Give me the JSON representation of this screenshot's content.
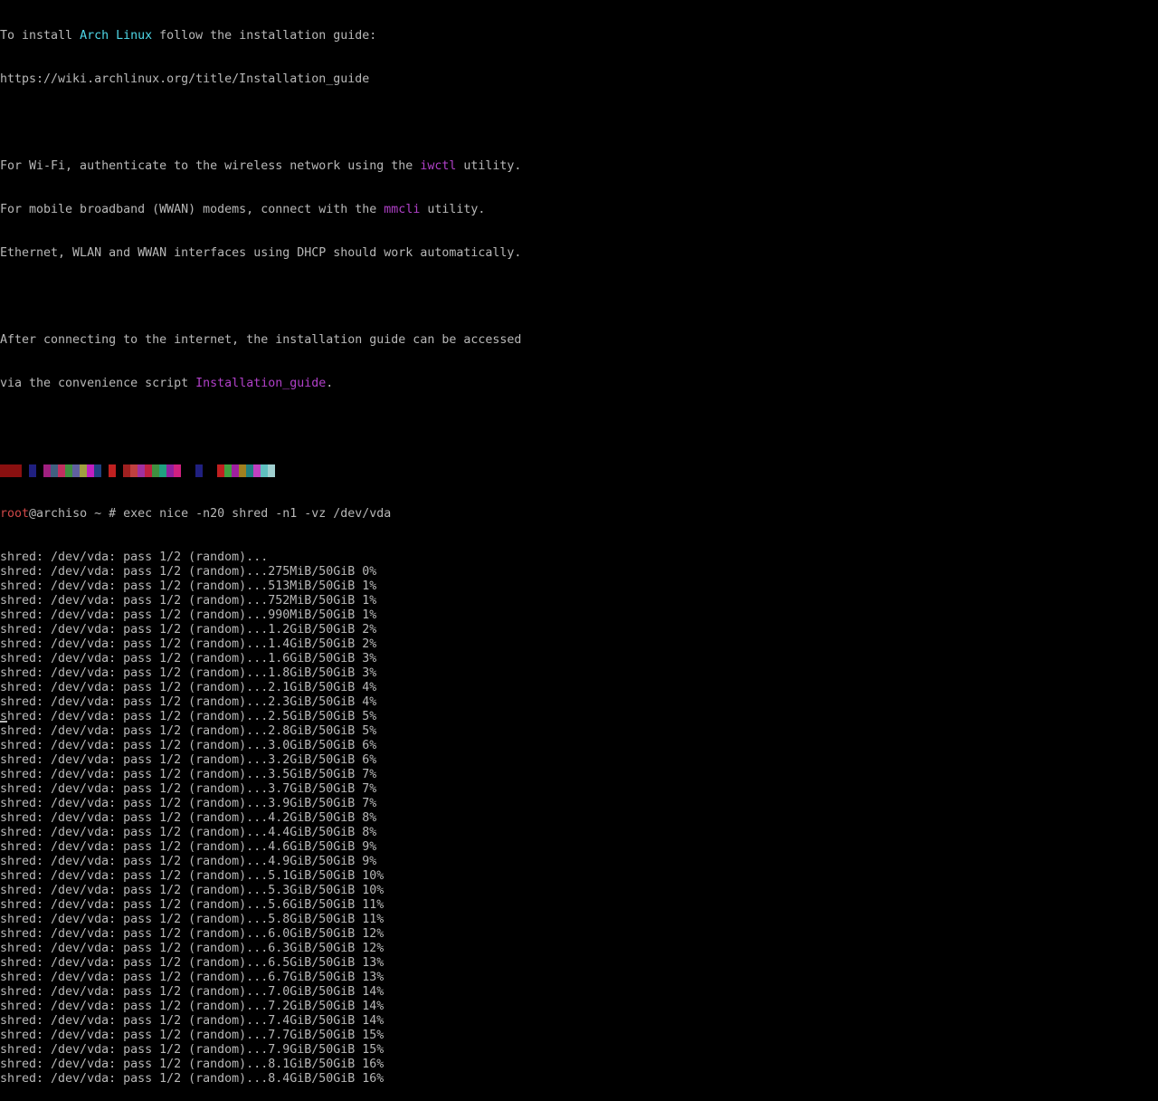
{
  "motd": {
    "l1_pre": "To install ",
    "l1_link": "Arch Linux",
    "l1_post": " follow the installation guide:",
    "l2": "https://wiki.archlinux.org/title/Installation_guide",
    "l4_pre": "For Wi-Fi, authenticate to the wireless network using the ",
    "l4_cmd": "iwctl",
    "l4_post": " utility.",
    "l5_pre": "For mobile broadband (WWAN) modems, connect with the ",
    "l5_cmd": "mmcli",
    "l5_post": " utility.",
    "l6": "Ethernet, WLAN and WWAN interfaces using DHCP should work automatically.",
    "l8": "After connecting to the internet, the installation guide can be accessed",
    "l9_pre": "via the convenience script ",
    "l9_cmd": "Installation_guide",
    "l9_post": "."
  },
  "color_bar": [
    {
      "color": "#8a1010",
      "w": 24
    },
    {
      "color": "#000000",
      "w": 8
    },
    {
      "color": "#202080",
      "w": 8
    },
    {
      "color": "#000000",
      "w": 8
    },
    {
      "color": "#a02080",
      "w": 8
    },
    {
      "color": "#406080",
      "w": 8
    },
    {
      "color": "#c03060",
      "w": 8
    },
    {
      "color": "#409040",
      "w": 8
    },
    {
      "color": "#6060a0",
      "w": 8
    },
    {
      "color": "#a0a040",
      "w": 8
    },
    {
      "color": "#c020c0",
      "w": 8
    },
    {
      "color": "#204080",
      "w": 8
    },
    {
      "color": "#000000",
      "w": 8
    },
    {
      "color": "#c02020",
      "w": 8
    },
    {
      "color": "#000000",
      "w": 8
    },
    {
      "color": "#a02020",
      "w": 8
    },
    {
      "color": "#c04040",
      "w": 8
    },
    {
      "color": "#a030a0",
      "w": 8
    },
    {
      "color": "#c02040",
      "w": 8
    },
    {
      "color": "#409040",
      "w": 8
    },
    {
      "color": "#20a080",
      "w": 8
    },
    {
      "color": "#9020a0",
      "w": 8
    },
    {
      "color": "#d02080",
      "w": 8
    },
    {
      "color": "#000000",
      "w": 16
    },
    {
      "color": "#202080",
      "w": 8
    },
    {
      "color": "#000000",
      "w": 16
    },
    {
      "color": "#c02020",
      "w": 8
    },
    {
      "color": "#40a040",
      "w": 8
    },
    {
      "color": "#a020a0",
      "w": 8
    },
    {
      "color": "#a08020",
      "w": 8
    },
    {
      "color": "#208080",
      "w": 8
    },
    {
      "color": "#c040c0",
      "w": 8
    },
    {
      "color": "#60c0c0",
      "w": 8
    },
    {
      "color": "#a0d0d0",
      "w": 8
    }
  ],
  "prompt": {
    "user": "root",
    "host": "@archiso",
    "rest": " ~ # exec nice -n20 shred -n1 -vz /dev/vda"
  },
  "shred_lines": [
    "shred: /dev/vda: pass 1/2 (random)...",
    "shred: /dev/vda: pass 1/2 (random)...275MiB/50GiB 0%",
    "shred: /dev/vda: pass 1/2 (random)...513MiB/50GiB 1%",
    "shred: /dev/vda: pass 1/2 (random)...752MiB/50GiB 1%",
    "shred: /dev/vda: pass 1/2 (random)...990MiB/50GiB 1%",
    "shred: /dev/vda: pass 1/2 (random)...1.2GiB/50GiB 2%",
    "shred: /dev/vda: pass 1/2 (random)...1.4GiB/50GiB 2%",
    "shred: /dev/vda: pass 1/2 (random)...1.6GiB/50GiB 3%",
    "shred: /dev/vda: pass 1/2 (random)...1.8GiB/50GiB 3%",
    "shred: /dev/vda: pass 1/2 (random)...2.1GiB/50GiB 4%",
    "shred: /dev/vda: pass 1/2 (random)...2.3GiB/50GiB 4%",
    "shred: /dev/vda: pass 1/2 (random)...2.5GiB/50GiB 5%",
    "shred: /dev/vda: pass 1/2 (random)...2.8GiB/50GiB 5%",
    "shred: /dev/vda: pass 1/2 (random)...3.0GiB/50GiB 6%",
    "shred: /dev/vda: pass 1/2 (random)...3.2GiB/50GiB 6%",
    "shred: /dev/vda: pass 1/2 (random)...3.5GiB/50GiB 7%",
    "shred: /dev/vda: pass 1/2 (random)...3.7GiB/50GiB 7%",
    "shred: /dev/vda: pass 1/2 (random)...3.9GiB/50GiB 7%",
    "shred: /dev/vda: pass 1/2 (random)...4.2GiB/50GiB 8%",
    "shred: /dev/vda: pass 1/2 (random)...4.4GiB/50GiB 8%",
    "shred: /dev/vda: pass 1/2 (random)...4.6GiB/50GiB 9%",
    "shred: /dev/vda: pass 1/2 (random)...4.9GiB/50GiB 9%",
    "shred: /dev/vda: pass 1/2 (random)...5.1GiB/50GiB 10%",
    "shred: /dev/vda: pass 1/2 (random)...5.3GiB/50GiB 10%",
    "shred: /dev/vda: pass 1/2 (random)...5.6GiB/50GiB 11%",
    "shred: /dev/vda: pass 1/2 (random)...5.8GiB/50GiB 11%",
    "shred: /dev/vda: pass 1/2 (random)...6.0GiB/50GiB 12%",
    "shred: /dev/vda: pass 1/2 (random)...6.3GiB/50GiB 12%",
    "shred: /dev/vda: pass 1/2 (random)...6.5GiB/50GiB 13%",
    "shred: /dev/vda: pass 1/2 (random)...6.7GiB/50GiB 13%",
    "shred: /dev/vda: pass 1/2 (random)...7.0GiB/50GiB 14%",
    "shred: /dev/vda: pass 1/2 (random)...7.2GiB/50GiB 14%",
    "shred: /dev/vda: pass 1/2 (random)...7.4GiB/50GiB 14%",
    "shred: /dev/vda: pass 1/2 (random)...7.7GiB/50GiB 15%",
    "shred: /dev/vda: pass 1/2 (random)...7.9GiB/50GiB 15%",
    "shred: /dev/vda: pass 1/2 (random)...8.1GiB/50GiB 16%",
    "shred: /dev/vda: pass 1/2 (random)...8.4GiB/50GiB 16%"
  ]
}
